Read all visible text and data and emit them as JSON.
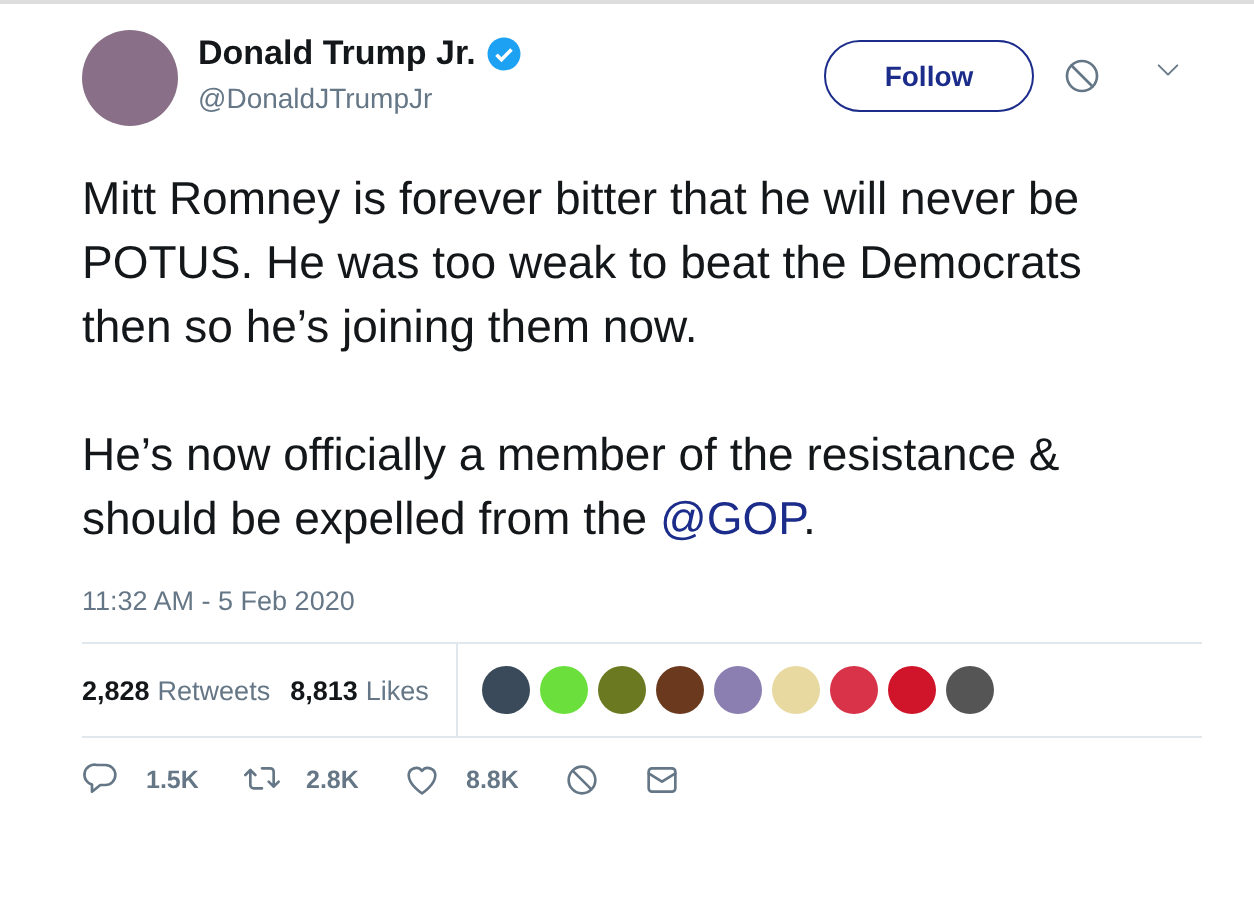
{
  "author": {
    "name": "Donald Trump Jr.",
    "handle": "@DonaldJTrumpJr",
    "verified": true
  },
  "follow_button": {
    "label": "Follow"
  },
  "tweet": {
    "paragraphs": [
      {
        "text": "Mitt Romney is forever bitter that he will never be POTUS. He was too weak to beat the Democrats then so he’s joining them now."
      },
      {
        "text": "He’s now officially a member of the resistance & should be expelled from the ",
        "mention": "@GOP",
        "after": "."
      }
    ]
  },
  "timestamp": "11:32 AM - 5 Feb 2020",
  "stats": [
    {
      "count": "2,828",
      "label": "Retweets"
    },
    {
      "count": "8,813",
      "label": "Likes"
    }
  ],
  "actions": [
    {
      "kind": "reply",
      "count": "1.5K"
    },
    {
      "kind": "retweet",
      "count": "2.8K"
    },
    {
      "kind": "like",
      "count": "8.8K"
    },
    {
      "kind": "block"
    },
    {
      "kind": "message"
    }
  ]
}
